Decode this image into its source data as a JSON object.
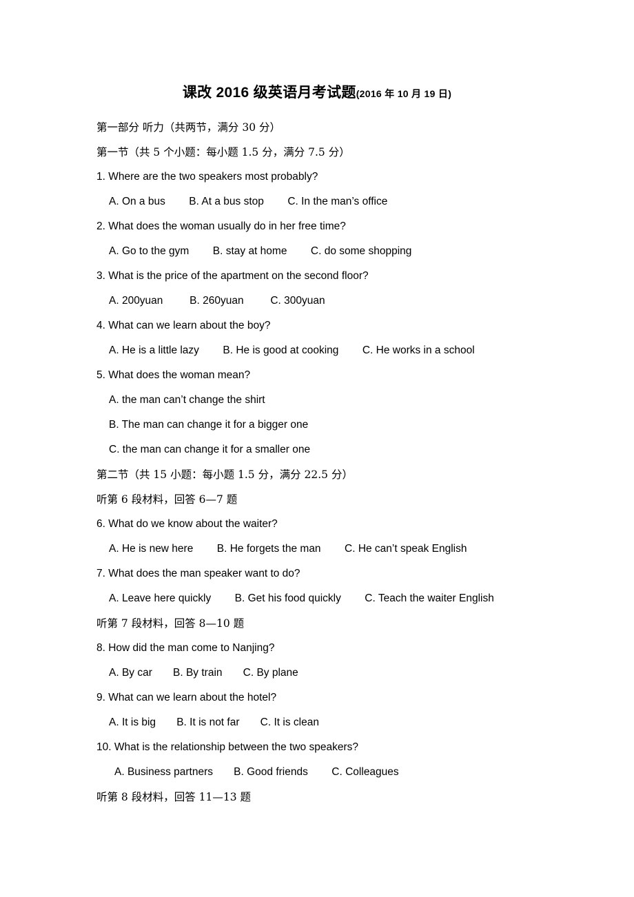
{
  "document": {
    "title_main": "课改 2016 级英语月考试题",
    "title_date": "(2016 年 10 月 19 日)",
    "part_heading": "第一部分 听力（共两节，满分 30 分）",
    "section_one_heading": "第一节（共 5 个小题：每小题 1.5 分，满分 7.5 分）",
    "section_two_heading": "第二节（共 15 小题：每小题 1.5 分，满分 22.5 分）",
    "material_6": "听第 6 段材料，回答 6—7 题",
    "material_7": "听第 7 段材料，回答 8—10 题",
    "material_8": "听第 8 段材料，回答 11—13 题"
  },
  "questions": [
    {
      "number": "1.",
      "text": "1. Where are the two speakers most probably?",
      "options_line": "A. On a bus        B. At a bus stop        C. In the man’s office",
      "options": [
        "A. On a bus",
        "B. At a bus stop",
        "C. In the man’s office"
      ]
    },
    {
      "number": "2.",
      "text": "2. What does the woman usually do in her free time?",
      "options_line": "A. Go to the gym        B. stay at home        C. do some shopping",
      "options": [
        "A. Go to the gym",
        "B. stay at home",
        "C. do some shopping"
      ]
    },
    {
      "number": "3.",
      "text": "3. What is the price of the apartment on the second floor?",
      "options_line": "A. 200yuan         B. 260yuan         C. 300yuan",
      "options": [
        "A. 200yuan",
        "B. 260yuan",
        "C. 300yuan"
      ]
    },
    {
      "number": "4.",
      "text": "4. What can we learn about the boy?",
      "options_line": "A. He is a little lazy        B. He is good at cooking        C. He works in a school",
      "options": [
        "A. He is a little lazy",
        "B. He is good at cooking",
        "C. He works in a school"
      ]
    },
    {
      "number": "5.",
      "text": "5. What does the woman mean?",
      "options": [
        "A. the man can’t change the shirt",
        "B. The man can change it for a bigger one",
        "C. the man can change it for a smaller one"
      ]
    },
    {
      "number": "6.",
      "text": "6. What do we know about the waiter?",
      "options_line": "A. He is new here        B. He forgets the man        C. He can’t speak English",
      "options": [
        "A. He is new here",
        "B. He forgets the man",
        "C. He can’t speak English"
      ]
    },
    {
      "number": "7.",
      "text": "7. What does the man speaker want to do?",
      "options_line": "A. Leave here quickly        B. Get his food quickly        C. Teach the waiter English",
      "options": [
        "A. Leave here quickly",
        "B. Get his food quickly",
        "C. Teach the waiter English"
      ]
    },
    {
      "number": "8.",
      "text": "8. How did the man come to Nanjing?",
      "options_line": "A. By car       B. By train       C. By plane",
      "options": [
        "A. By car",
        "B. By train",
        "C. By plane"
      ]
    },
    {
      "number": "9.",
      "text": "9. What can we learn about the hotel?",
      "options_line": "A. It is big       B. It is not far       C. It is clean",
      "options": [
        "A. It is big",
        "B. It is not far",
        "C. It is clean"
      ]
    },
    {
      "number": "10.",
      "text": "10. What is the relationship between the two speakers?",
      "options_line": "A. Business partners       B. Good friends        C. Colleagues",
      "options": [
        "A. Business partners",
        "B. Good friends",
        "C. Colleagues"
      ]
    }
  ]
}
